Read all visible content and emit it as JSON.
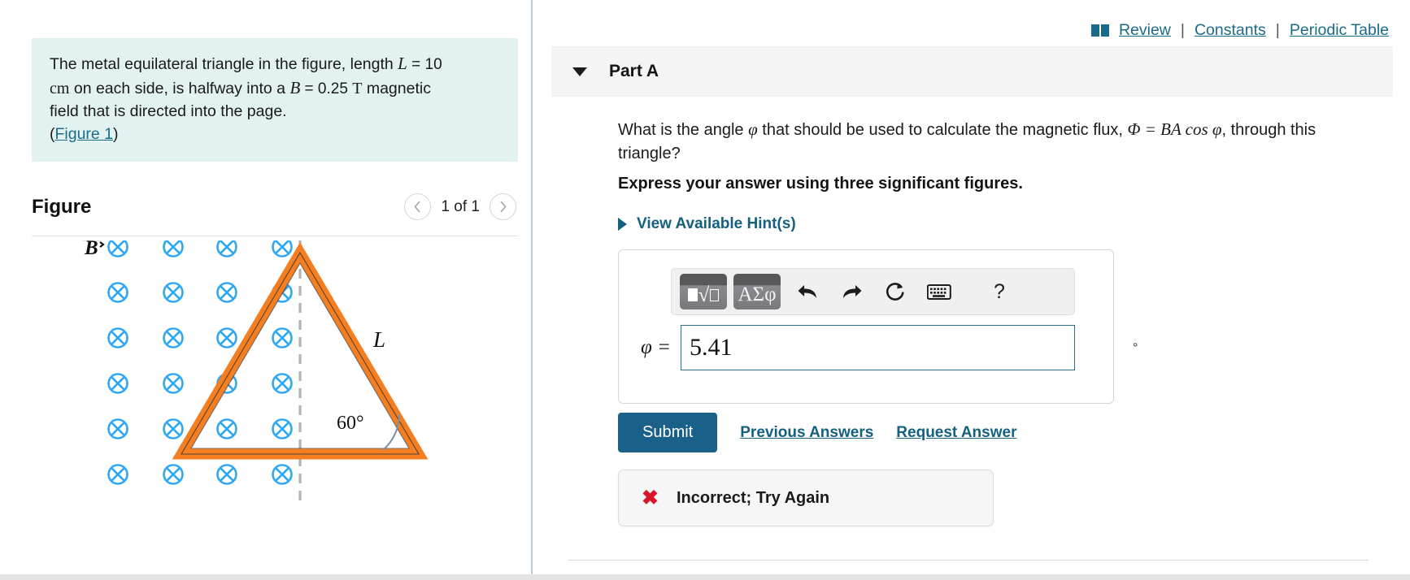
{
  "left": {
    "problem": {
      "line1_a": "The metal equilateral triangle in the figure, length ",
      "var_L": "L",
      "eq1": " = 10",
      "unit_cm": "cm",
      "line2_a": " on each side, is halfway into a ",
      "var_B": "B",
      "eq2": " = 0.25 ",
      "unit_T": "T",
      "line2_b": " magnetic",
      "line3": "field that is directed into the page.",
      "figure_link_open": "(",
      "figure_link": "Figure 1",
      "figure_link_close": ")"
    },
    "figure": {
      "title": "Figure",
      "counter": "1 of 1",
      "prev_icon": "chevron-left-icon",
      "next_icon": "chevron-right-icon",
      "b_label": "B",
      "side_label": "L",
      "angle_label": "60°",
      "field_symbol": "x-in-circle",
      "field_color": "#2FA8F0",
      "triangle_color": "#F57E20",
      "field_rows": 6,
      "field_cols": 4
    }
  },
  "right": {
    "toplinks": {
      "book_icon": "book-icon",
      "review": "Review",
      "sep1": "|",
      "constants": "Constants",
      "sep2": "|",
      "periodic_table": "Periodic Table"
    },
    "part": {
      "caret_icon": "caret-down-icon",
      "label": "Part A"
    },
    "question": {
      "text_a": "What is the angle ",
      "phi": "φ",
      "text_b": " that should be used to calculate the magnetic flux, ",
      "formula": "Φ = BA cos φ",
      "text_c": ", through this triangle?",
      "note": "Express your answer using three significant figures."
    },
    "hints": {
      "caret_icon": "caret-right-icon",
      "label": "View Available Hint(s)"
    },
    "toolbar": {
      "template_button": "math-template-icon",
      "greek_button": "ΑΣφ",
      "undo_icon": "undo-icon",
      "redo_icon": "redo-icon",
      "reset_icon": "reset-icon",
      "keyboard_icon": "keyboard-icon",
      "help_label": "?"
    },
    "answer": {
      "variable_label": "φ =",
      "value": "5.41",
      "placeholder": "",
      "unit": "°"
    },
    "actions": {
      "submit": "Submit",
      "previous_answers": "Previous Answers",
      "request_answer": "Request Answer"
    },
    "feedback": {
      "icon": "x-cross-icon",
      "text": "Incorrect; Try Again",
      "color": "#D8182A"
    }
  }
}
